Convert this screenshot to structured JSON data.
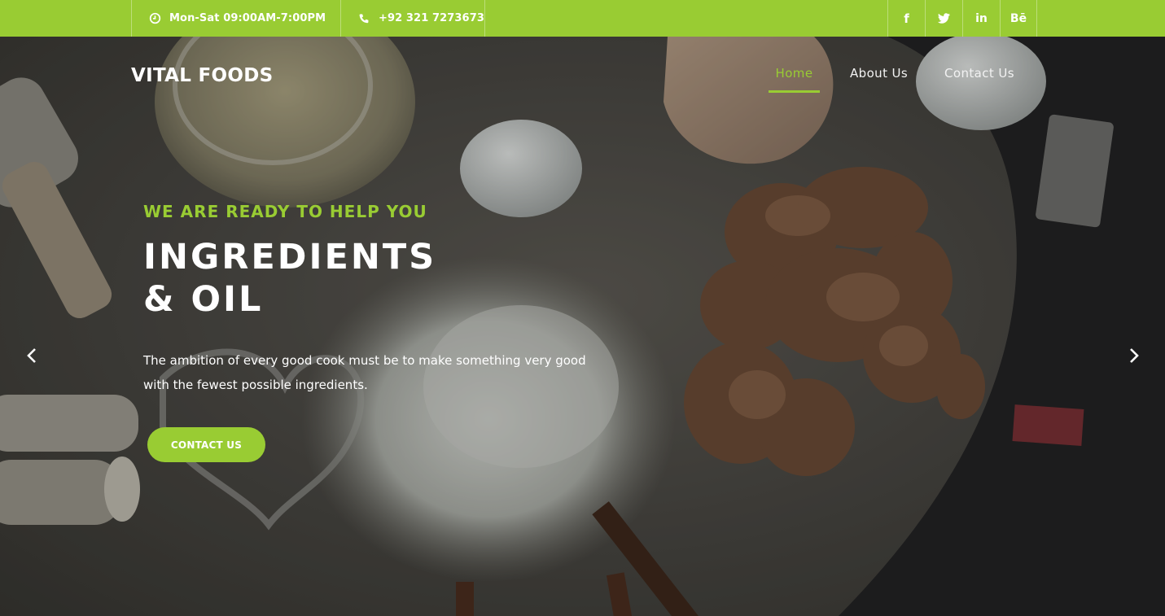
{
  "topbar": {
    "hours": "Mon-Sat 09:00AM-7:00PM",
    "phone": "+92 321 7273673",
    "hours_icon": "clock-icon",
    "phone_icon": "phone-icon",
    "social": {
      "facebook": "f",
      "twitter": "twitter-icon",
      "linkedin": "in",
      "behance": "Bē"
    }
  },
  "brand": "VITAL FOODS",
  "nav": {
    "home": "Home",
    "about": "About Us",
    "contact": "Contact Us"
  },
  "hero": {
    "kicker": "WE ARE READY TO HELP YOU",
    "headline_line1": "INGREDIENTS",
    "headline_line2": "& OIL",
    "lede": "The ambition of every good cook must be to make something very good with the fewest possible ingredients.",
    "cta": "CONTACT US"
  },
  "colors": {
    "accent": "#99cc33",
    "text": "#ffffff"
  }
}
